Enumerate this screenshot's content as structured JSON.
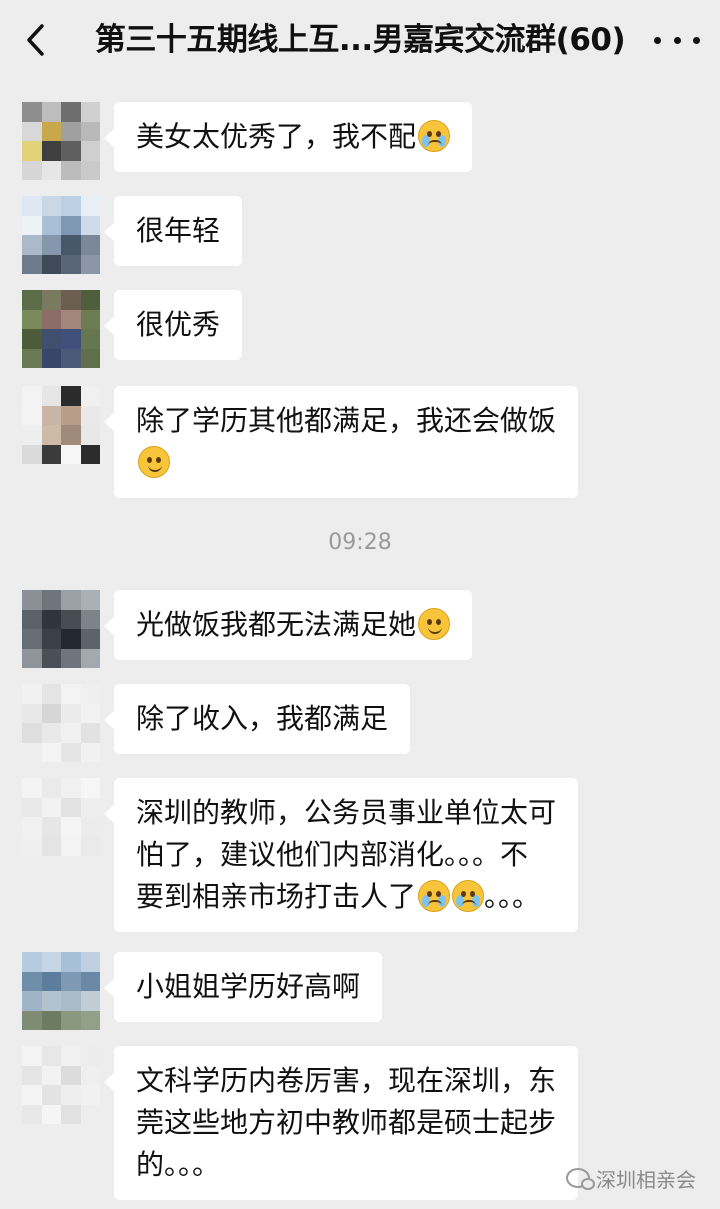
{
  "header": {
    "title": "第三十五期线上互...男嘉宾交流群(60)",
    "back_icon": "chevron-left-icon",
    "more_icon": "more-horizontal-icon"
  },
  "messages": [
    {
      "text": "美女太优秀了，我不配",
      "emoji": "cry",
      "avatar": [
        "#8e8e8e",
        "#bdbdbd",
        "#6e6e6e",
        "#d0d0d0",
        "#d8d8d8",
        "#c8a84a",
        "#a0a0a0",
        "#b9b9b9",
        "#e2d27a",
        "#3f3f3f",
        "#5f5f5f",
        "#cfcfcf",
        "#d6d6d6",
        "#e6e6e6",
        "#bcbcbc",
        "#cacaca"
      ]
    },
    {
      "text": "很年轻",
      "avatar": [
        "#dfe8f2",
        "#c9d7e6",
        "#bcd0e4",
        "#e8eef5",
        "#eef2f7",
        "#a9bfd7",
        "#7f97b3",
        "#cfdbe8",
        "#aabacb",
        "#8597ad",
        "#48586b",
        "#7a8899",
        "#6d7b8c",
        "#3e4a58",
        "#586576",
        "#8b97a6"
      ]
    },
    {
      "text": "很优秀",
      "avatar": [
        "#5c6b48",
        "#7a7a60",
        "#6d5e52",
        "#4f5f3c",
        "#7b8a5a",
        "#8d6d67",
        "#a2857c",
        "#6e7c52",
        "#4e5b3a",
        "#3f4f6d",
        "#41507b",
        "#667650",
        "#6a7a55",
        "#3a456a",
        "#4a5a78",
        "#5f6f4a"
      ]
    },
    {
      "text": "除了学历其他都满足，我还会做饭",
      "emoji_line2": "smile",
      "avatar": [
        "#f3f3f3",
        "#e6e6e6",
        "#2b2b2b",
        "#f0f0f0",
        "#f4f4f4",
        "#c9b5a5",
        "#b89d88",
        "#e9e9e9",
        "#eeeeee",
        "#cfb9a7",
        "#a08a7a",
        "#e8e8e8",
        "#dadada",
        "#3b3b3b",
        "#f6f6f6",
        "#2c2c2c"
      ]
    },
    {
      "text": "光做饭我都无法满足她",
      "emoji": "smile",
      "avatar": [
        "#8a9096",
        "#6e757c",
        "#9aa0a6",
        "#aab0b6",
        "#5b6168",
        "#2f353c",
        "#474d54",
        "#7d838a",
        "#676d74",
        "#3a4047",
        "#222830",
        "#5d636a",
        "#8e949a",
        "#4a5057",
        "#6f757c",
        "#a3a9ae"
      ]
    },
    {
      "text": "除了收入，我都满足",
      "avatar": [
        "#f1f1f1",
        "#e4e4e4",
        "#f3f3f3",
        "#efefef",
        "#e8e8e8",
        "#d6d6d6",
        "#ebebeb",
        "#f2f2f2",
        "#dedede",
        "#e9e9e9",
        "#f0f0f0",
        "#e2e2e2",
        "#eeeeee",
        "#f4f4f4",
        "#e5e5e5",
        "#f1f1f1"
      ]
    },
    {
      "lines": [
        "深圳的教师，公务员事业单位太可",
        "怕了，建议他们内部消化。。。不",
        "要到相亲市场打击人了"
      ],
      "line3_suffix": "。。。",
      "line3_emojis": [
        "cry",
        "cry"
      ],
      "avatar": [
        "#f4f4f4",
        "#eaeaea",
        "#f0f0f0",
        "#f6f6f6",
        "#e9e9e9",
        "#f2f2f2",
        "#e3e3e3",
        "#eeeeee",
        "#f1f1f1",
        "#e6e6e6",
        "#f5f5f5",
        "#ececec",
        "#efefef",
        "#e4e4e4",
        "#f3f3f3",
        "#eaeaea"
      ]
    },
    {
      "text": "小姐姐学历好高啊",
      "avatar": [
        "#b6cbe0",
        "#c4d5e6",
        "#a7bfd8",
        "#bed0e2",
        "#6f8eaa",
        "#5c7d9b",
        "#7d99b3",
        "#6a89a6",
        "#9fb4c6",
        "#b3c2cf",
        "#a9bac9",
        "#c0ccd6",
        "#7e8c74",
        "#6d7b63",
        "#8a9880",
        "#93a089"
      ]
    },
    {
      "lines": [
        "文科学历内卷厉害，现在深圳，东",
        "莞这些地方初中教师都是硕士起步",
        "的。。。"
      ],
      "avatar": [
        "#f3f3f3",
        "#e7e7e7",
        "#f0f0f0",
        "#ececec",
        "#e5e5e5",
        "#f2f2f2",
        "#dcdcdc",
        "#efefef",
        "#f4f4f4",
        "#e3e3e3",
        "#eeeeee",
        "#f1f1f1",
        "#e8e8e8",
        "#f5f5f5",
        "#e1e1e1",
        "#ededed"
      ]
    }
  ],
  "timestamp": "09:28",
  "watermark": {
    "text": "深圳相亲会",
    "icon": "wechat-icon"
  },
  "colors": {
    "background": "#ededed",
    "bubble": "#ffffff",
    "timestamp": "#9a9a9a"
  }
}
